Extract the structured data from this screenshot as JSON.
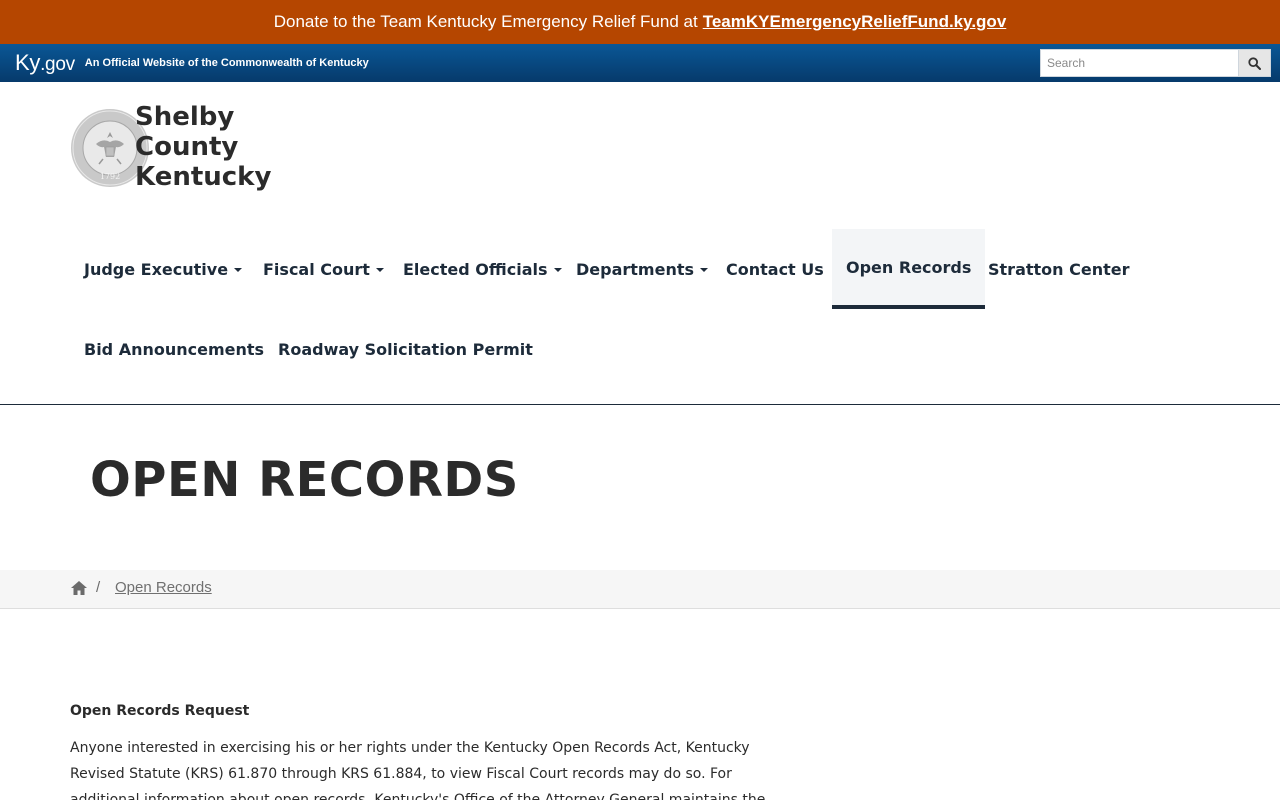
{
  "donate_banner": {
    "text": "Donate to the Team Kentucky Emergency Relief Fund at",
    "link": "TeamKYEmergencyReliefFund.ky.gov"
  },
  "kygov_bar": {
    "logo_main": "Ky",
    "logo_suffix": ".gov",
    "tagline": "An Official Website of the Commonwealth of Kentucky",
    "search_placeholder": "Search"
  },
  "site": {
    "title_line1": "Shelby",
    "title_line2": "County",
    "title_line3": "Kentucky",
    "seal_year": "1792"
  },
  "nav": {
    "items": [
      {
        "label": "Judge Executive",
        "dropdown": true
      },
      {
        "label": "Fiscal Court",
        "dropdown": true
      },
      {
        "label": "Elected Officials",
        "dropdown": true
      },
      {
        "label": "Departments",
        "dropdown": true
      },
      {
        "label": "Contact Us",
        "dropdown": false
      },
      {
        "label": "Open Records",
        "dropdown": false,
        "active": true
      },
      {
        "label": "Stratton Center",
        "dropdown": false
      },
      {
        "label": "Bid Announcements",
        "dropdown": false
      },
      {
        "label": "Roadway Solicitation Permit",
        "dropdown": false
      }
    ]
  },
  "page": {
    "title": "OPEN RECORDS"
  },
  "breadcrumb": {
    "separator": "/",
    "current": "Open Records"
  },
  "content": {
    "heading": "Open Records Request",
    "paragraph": "Anyone interested in exercising his or her rights under the Kentucky Open Records Act, Kentucky Revised Statute (KRS) 61.870 through KRS 61.884, to view Fiscal Court records may do so. For additional information about open records, Kentucky's Office of the Attorney General maintains the"
  },
  "colors": {
    "donate_bg": "#b54600",
    "kygov_bar": "#0a5796",
    "nav_text": "#1d2b3a"
  }
}
